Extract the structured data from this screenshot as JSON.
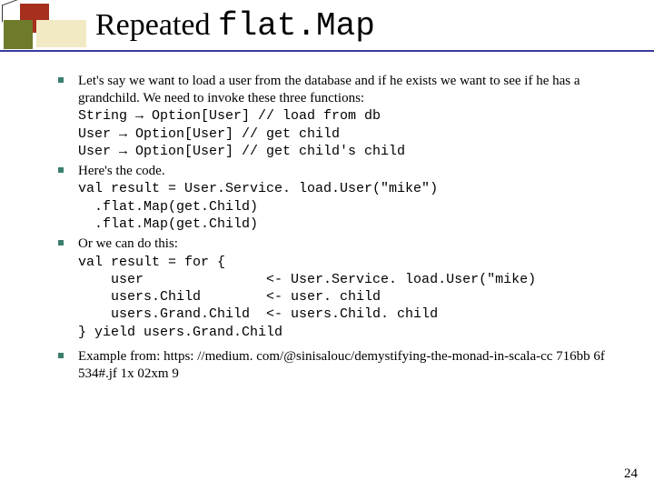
{
  "title": {
    "word1": "Repeated ",
    "word2": "flat.Map"
  },
  "bullets": [
    {
      "lead": "Let's say we want to load a user from the database and if he exists we want to see if he has a grandchild. We need to invoke these three functions:",
      "code": "String → Option[User] // load from db\nUser → Option[User] // get child\nUser → Option[User] // get child's child"
    },
    {
      "lead": "Here's the code.",
      "code": "val result = User.Service. load.User(\"mike\")\n  .flat.Map(get.Child)\n  .flat.Map(get.Child)"
    },
    {
      "lead": "Or we can do this:",
      "code": "val result = for {\n    user               <- User.Service. load.User(\"mike)\n    users.Child        <- user. child\n    users.Grand.Child  <- users.Child. child\n} yield users.Grand.Child"
    },
    {
      "lead": "Example from: https: //medium. com/@sinisalouc/demystifying-the-monad-in-scala-cc 716bb 6f 534#.jf 1x 02xm 9",
      "code": ""
    }
  ],
  "pagenum": "24"
}
